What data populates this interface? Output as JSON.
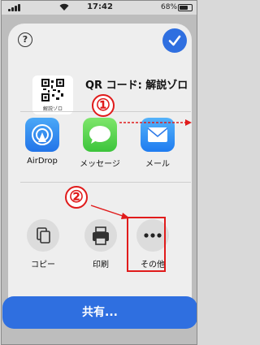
{
  "status_bar": {
    "time": "17:42",
    "battery_percent": "68%"
  },
  "sheet": {
    "help_glyph": "?",
    "title": "QR コード: 解説ゾロ",
    "thumb_caption": "解説ゾロ"
  },
  "markers": {
    "first": "①",
    "second": "②"
  },
  "apps": [
    {
      "label": "AirDrop",
      "icon": "airdrop-icon"
    },
    {
      "label": "メッセージ",
      "icon": "messages-icon"
    },
    {
      "label": "メール",
      "icon": "mail-icon"
    }
  ],
  "actions": [
    {
      "label": "コピー",
      "icon": "copy-icon"
    },
    {
      "label": "印刷",
      "icon": "print-icon"
    },
    {
      "label": "その他",
      "icon": "more-icon"
    }
  ],
  "share_button": {
    "label": "共有..."
  },
  "colors": {
    "accent": "#2f6fe0",
    "annotation": "#e01b1b"
  }
}
